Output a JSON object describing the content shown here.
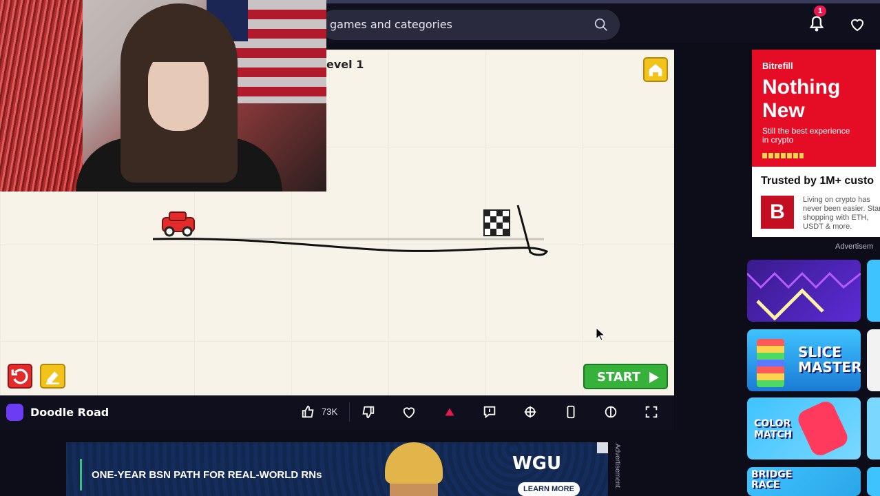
{
  "search": {
    "placeholder": "games and categories",
    "icon": "search-icon"
  },
  "header": {
    "notification_count": "1"
  },
  "game": {
    "level_label": "evel 1",
    "start_label": "START"
  },
  "game_bar": {
    "title": "Doodle Road",
    "likes": "73K"
  },
  "bottom_ad": {
    "headline": "ONE-YEAR BSN PATH FOR REAL-WORLD RNs",
    "brand": "WGU",
    "cta": "LEARN MORE",
    "vertical_label": "Advertisement"
  },
  "side_ad": {
    "brand": "Bitrefill",
    "headline": "Nothing New",
    "subtext": "Still the best experience in crypto",
    "trusted": "Trusted by 1M+ custo",
    "logo_letter": "B",
    "small_text": "Living on crypto has never been easier. Start shopping with ETH, USDT & more.",
    "advert_label": "Advertisem"
  },
  "thumbs": [
    {
      "label": ""
    },
    {
      "label": "SLICE MASTER"
    },
    {
      "label": "COLOR MATCH"
    },
    {
      "label": "BRIDGE RACE"
    }
  ],
  "colors": {
    "accent": "#6c3cf5",
    "start": "#36b13a",
    "alert": "#e32b2b",
    "badge": "#e8194d"
  }
}
